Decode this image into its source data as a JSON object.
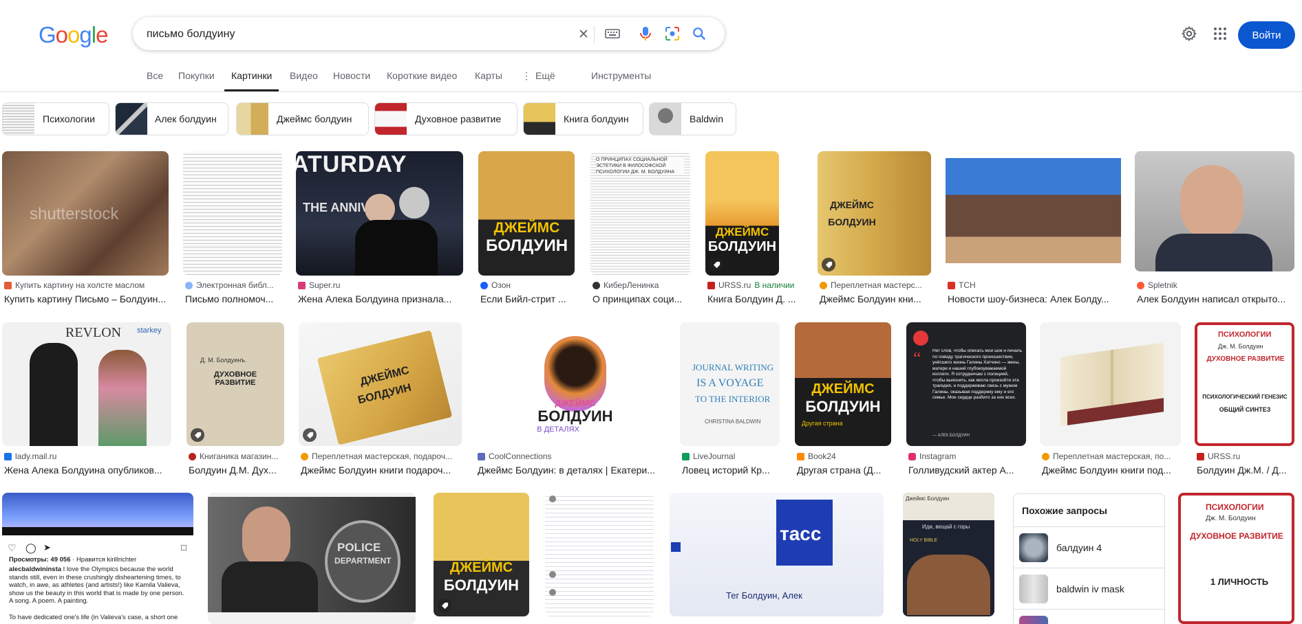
{
  "logo": {
    "text": [
      "G",
      "o",
      "o",
      "g",
      "l",
      "e"
    ],
    "colors": [
      "#4285f4",
      "#ea4335",
      "#fbbc05",
      "#4285f4",
      "#34a853",
      "#ea4335"
    ]
  },
  "search": {
    "query": "письмо болдуину"
  },
  "header": {
    "login_label": "Войти"
  },
  "tabs": [
    {
      "label": "Все"
    },
    {
      "label": "Покупки"
    },
    {
      "label": "Картинки",
      "active": true
    },
    {
      "label": "Видео"
    },
    {
      "label": "Новости"
    },
    {
      "label": "Короткие видео"
    },
    {
      "label": "Карты"
    },
    {
      "label": "Ещё"
    },
    {
      "label": "Инструменты"
    }
  ],
  "chips": [
    {
      "label": "Психологии"
    },
    {
      "label": "Алек болдуин"
    },
    {
      "label": "Джеймс болдуин"
    },
    {
      "label": "Духовное развитие"
    },
    {
      "label": "Книга болдуин"
    },
    {
      "label": "Baldwin"
    }
  ],
  "results_row1": [
    {
      "source": "Купить картину на холсте маслом",
      "title": "Купить картину Письмо – Болдуин..."
    },
    {
      "source": "Электронная библ...",
      "title": "Письмо полномоч..."
    },
    {
      "source": "Super.ru",
      "title": "Жена Алека Болдуина признала..."
    },
    {
      "source": "Озон",
      "title": "Если Бийл-стрит ..."
    },
    {
      "source": "КиберЛенинка",
      "title": "О принципах соци..."
    },
    {
      "source": "URSS.ru",
      "stock": "В наличии",
      "title": "Книга Болдуин Д. ..."
    },
    {
      "source": "Переплетная мастерс...",
      "title": "Джеймс Болдуин кни..."
    },
    {
      "source": "ТСН",
      "title": "Новости шоу-бизнеса: Алек Болду..."
    },
    {
      "source": "Spletnik",
      "title": "Алек Болдуин написал открыто..."
    }
  ],
  "results_row2": [
    {
      "source": "lady.mail.ru",
      "title": "Жена Алека Болдуина опубликов..."
    },
    {
      "source": "Книганика магазин...",
      "title": "Болдуин Д.М. Дух..."
    },
    {
      "source": "Переплетная мастерская, подароч...",
      "title": "Джеймс Болдуин книги подароч..."
    },
    {
      "source": "CoolConnections",
      "title": "Джеймс Болдуин: в деталях | Екатери..."
    },
    {
      "source": "LiveJournal",
      "title": "Ловец историй Кр..."
    },
    {
      "source": "Book24",
      "title": "Другая страна (Д..."
    },
    {
      "source": "Instagram",
      "title": "Голливудский актер А..."
    },
    {
      "source": "Переплетная мастерская, по...",
      "title": "Джеймс Болдуин книги под..."
    },
    {
      "source": "URSS.ru",
      "title": "Болдуин Дж.М. / Д..."
    }
  ],
  "image_text": {
    "book_author": "ДЖЕЙМС",
    "book_name": "БОЛДУИН",
    "snl": "ATURDAY",
    "snl2": "THE ANNIVE",
    "tass": "тасс",
    "tass_caption": "Тег Болдуин, Алек",
    "journal1": "JOURNAL WRITING",
    "journal2": "IS A VOYAGE",
    "journal3": "TO THE INTERIOR",
    "journal4": "CHRISTINA BALDWIN",
    "cc_name1": "ДЖЕЙМС",
    "cc_name2": "БОЛДУИН",
    "cc_sub": "В ДЕТАЛЯХ",
    "urss_title": "ДУХОВНОЕ РАЗВИТИЕ",
    "urss_head": "ПСИХОЛОГИИ",
    "urss_author": "Дж. М. Болдуин",
    "urss_sub": "ПСИХОЛОГИЧЕСКИЙ ГЕНЕЗИС",
    "urss_sub2": "ОБЩИЙ СИНТЕЗ",
    "insta_views": "Просмотры: 49 056",
    "insta_likes": "· Нравится kirillrichter",
    "insta_user": "alecbaldwininsta",
    "insta_text": "I love the Olympics because the world stands still, even in these crushingly disheartening times, to watch, in awe, as athletes (and artists!) like Kamila Valieva, show us the beauty in this world that is made by one person. A song. A poem. A painting.",
    "insta_text2": "To have dedicated one's life (in Valieva's case, a short one",
    "police": "POLICE",
    "department": "DEPARTMENT",
    "bible_author": "Джеймс Болдуин",
    "bible_title": "Иди, вещай с горы",
    "bible_holy": "HOLY BIBLE",
    "quote": "Нет слов, чтобы описать мои шок и печаль по поводу трагического происшествия, унёсшего жизнь Галины Хатчинс — жены, матери и нашей глубокоуважаемой коллеги. Я сотрудничаю с полицией, чтобы выяснить, как могла произойти эта трагедия, и поддерживаю связь с мужем Галины, оказывая поддержку ему и его семье. Мое сердце разбито за них всех.",
    "quote_author": "— АЛЕК БОЛДУИН",
    "shutter": "shutterstock",
    "old_book_title": "ДУХОВНОЕ РАЗВИТИЕ",
    "old_book_author": "Д. М. Болдуинъ.",
    "revlon": "REVLON",
    "starkey": "starkey",
    "principles": "О ПРИНЦИПАХ СОЦИАЛЬНОЙ ЭСТЕТИКИ В ФИЛОСОФСКОЙ ПСИХОЛОГИИ ДЖ. М. БОЛДУИНА",
    "other_country": "Другая страна",
    "urss2_title": "ДУХОВНОЕ РАЗВИТИЕ",
    "urss2_sub": "1 ЛИЧНОСТЬ"
  },
  "related": {
    "title": "Похожие запросы",
    "items": [
      {
        "label": "балдуин 4"
      },
      {
        "label": "baldwin iv mask"
      }
    ]
  },
  "colors": {
    "accent": "#0b57d0",
    "text_secondary": "#5f6368",
    "border": "#dadce0"
  }
}
